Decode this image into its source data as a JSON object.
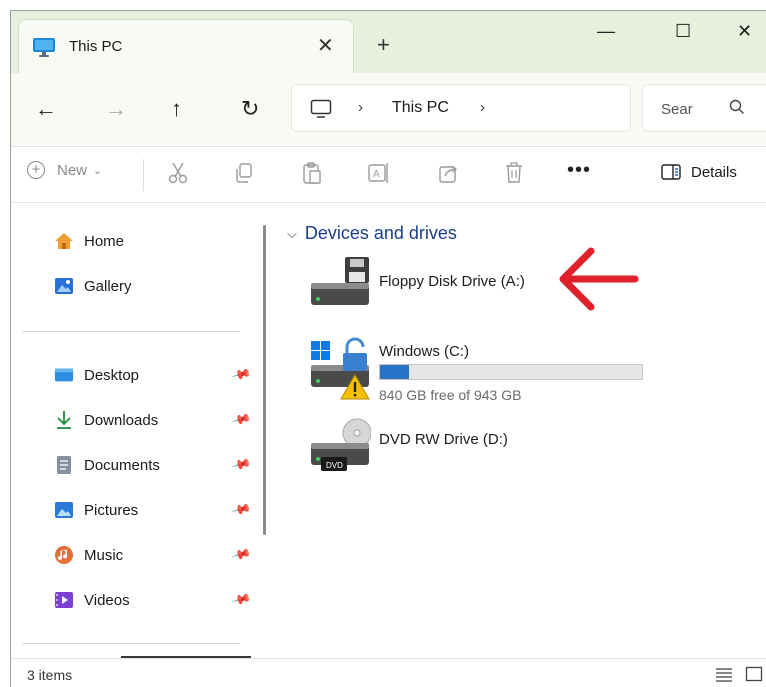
{
  "window": {
    "tab_title": "This PC",
    "tab_close": "✕",
    "new_tab": "+",
    "minimize": "—",
    "maximize": "☐",
    "close": "✕"
  },
  "nav": {
    "back": "←",
    "forward": "→",
    "up": "↑",
    "refresh": "↻",
    "separator": "›",
    "breadcrumb": [
      "This PC"
    ],
    "search_placeholder": "Sear"
  },
  "commands": {
    "new_label": "New",
    "more": "•••",
    "details_label": "Details"
  },
  "sidebar": {
    "top_items": [
      {
        "label": "Home",
        "icon": "home-icon"
      },
      {
        "label": "Gallery",
        "icon": "gallery-icon"
      }
    ],
    "quick_access": [
      {
        "label": "Desktop",
        "icon": "desktop-folder-icon"
      },
      {
        "label": "Downloads",
        "icon": "downloads-icon"
      },
      {
        "label": "Documents",
        "icon": "documents-icon"
      },
      {
        "label": "Pictures",
        "icon": "pictures-icon"
      },
      {
        "label": "Music",
        "icon": "music-icon"
      },
      {
        "label": "Videos",
        "icon": "videos-icon"
      }
    ]
  },
  "content": {
    "group_title": "Devices and drives",
    "drives": [
      {
        "name": "Floppy Disk Drive (A:)",
        "icon": "floppy-drive-icon"
      },
      {
        "name": "Windows (C:)",
        "icon": "windows-drive-icon",
        "free_text": "840 GB free of 943 GB",
        "used_fraction": 0.11
      },
      {
        "name": "DVD RW Drive (D:)",
        "icon": "dvd-drive-icon",
        "badge": "DVD"
      }
    ],
    "annotation_color": "#e0202a"
  },
  "status": {
    "item_count": "3 items"
  },
  "colors": {
    "titlebar": "#e6f0dc",
    "accent": "#1a3e8c",
    "progress": "#2673c8"
  }
}
